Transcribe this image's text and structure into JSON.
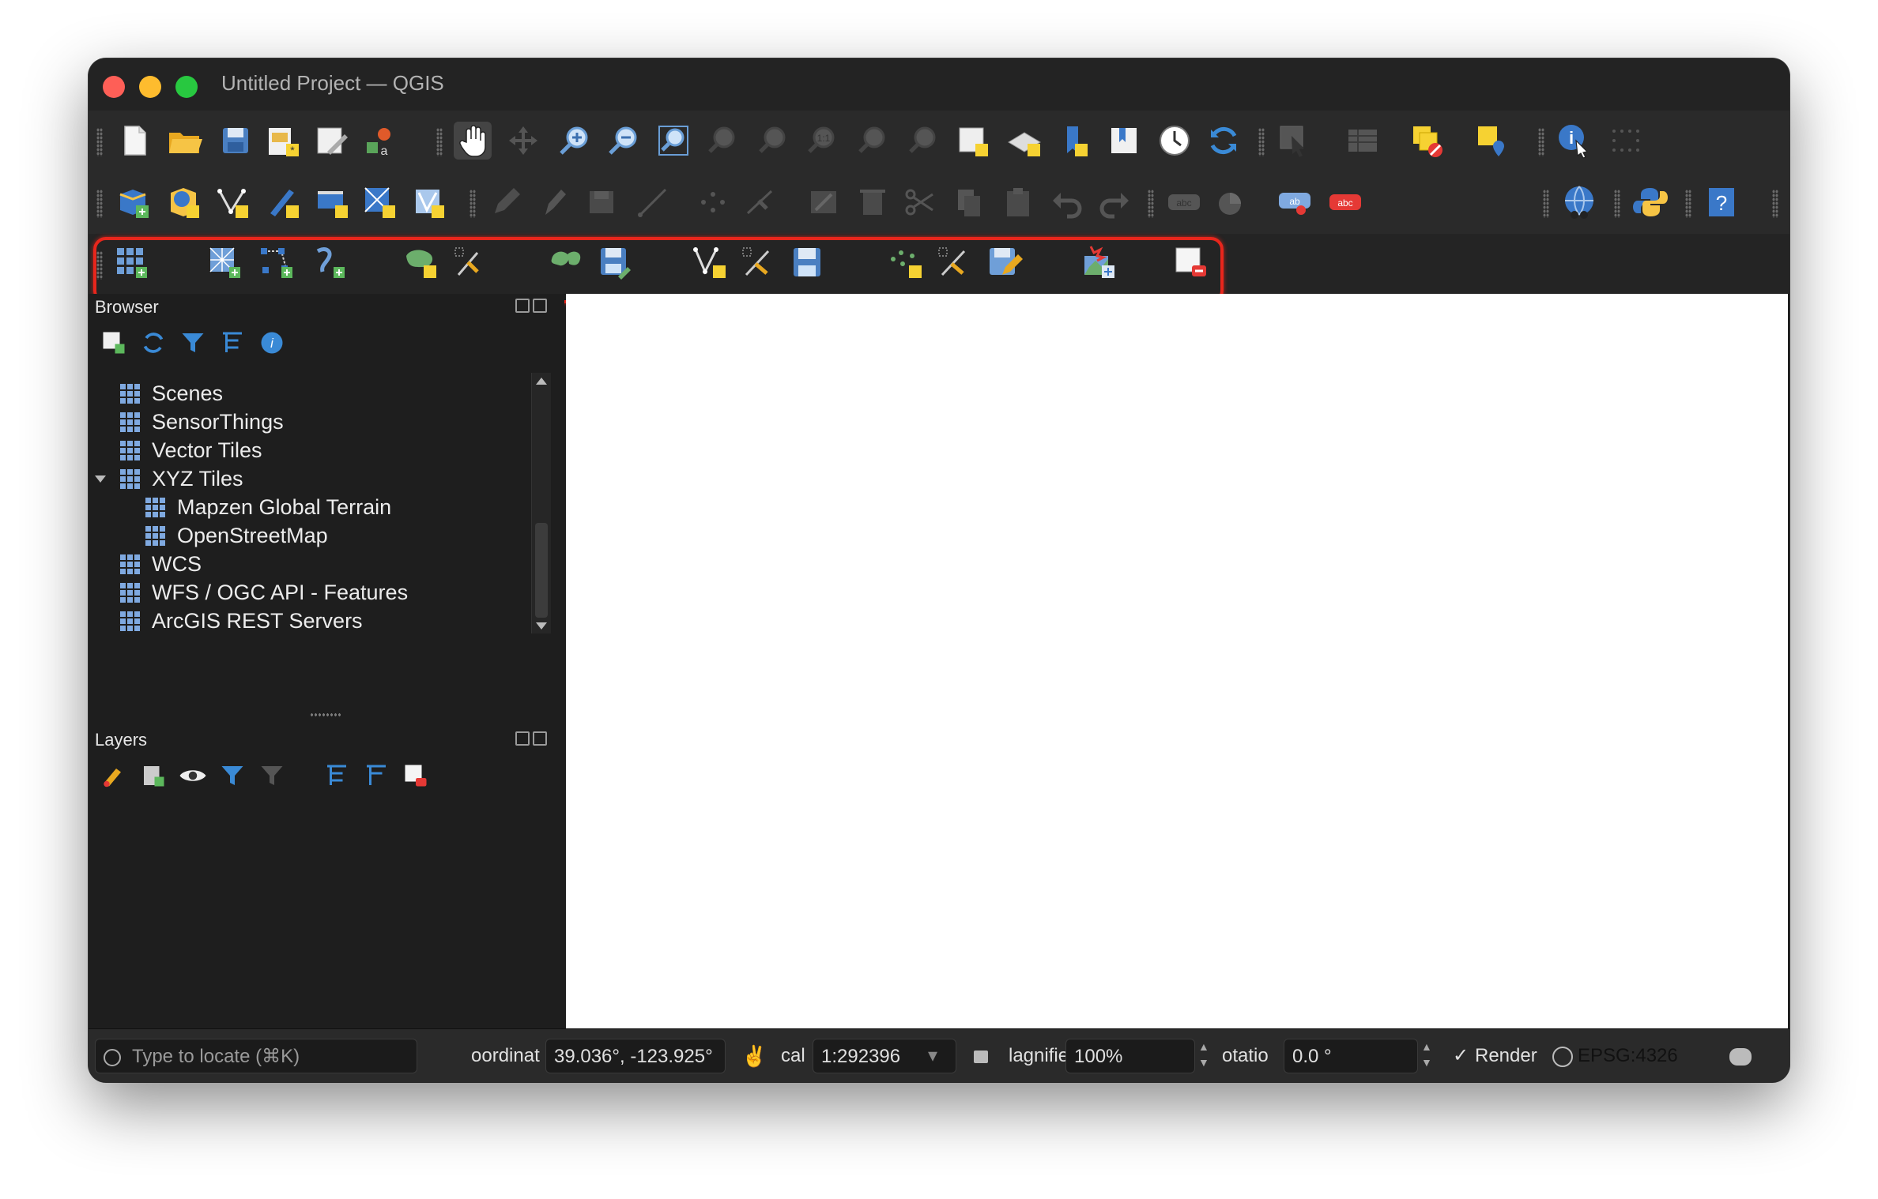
{
  "window": {
    "title": "Untitled Project — QGIS"
  },
  "toolbar_rows": {
    "row1": [
      "new-project-icon",
      "open-project-icon",
      "save-project-icon",
      "new-print-layout-icon",
      "layout-manager-icon",
      "style-manager-icon",
      "pan-map-icon",
      "pan-to-selection-icon",
      "zoom-in-icon",
      "zoom-out-icon",
      "zoom-full-icon",
      "zoom-to-selection-icon",
      "zoom-to-layer-icon",
      "zoom-native-icon",
      "zoom-last-icon",
      "zoom-next-icon",
      "new-map-view-icon",
      "new-3d-view-icon",
      "new-bookmark-icon",
      "show-bookmarks-icon",
      "temporal-controller-icon",
      "refresh-icon",
      "select-features-icon",
      "open-attribute-table-icon",
      "deselect-all-icon",
      "show-map-tips-icon",
      "identify-features-icon",
      "measure-icon"
    ],
    "row2": [
      "data-source-manager-icon",
      "new-geopackage-layer-icon",
      "digitize-vertex-icon",
      "new-sketch-icon",
      "new-memory-layer-icon",
      "new-virtual-layer-icon",
      "new-spatialite-layer-icon",
      "toggle-editing-icon",
      "current-edits-icon",
      "save-edits-icon",
      "digitize-line-icon",
      "add-point-icon",
      "vertex-tool-icon",
      "modify-attributes-icon",
      "delete-selected-icon",
      "cut-features-icon",
      "copy-features-icon",
      "paste-features-icon",
      "undo-icon",
      "redo-icon",
      "label-toolbar-icon",
      "diagram-icon",
      "label-highlight-icon",
      "label-pin-icon",
      "metasearch-icon",
      "python-console-icon",
      "help-icon"
    ]
  },
  "highlighted_toolbar": {
    "icons": [
      "add-wms-layer-icon",
      "add-wcs-layer-icon",
      "add-vector-tile-layer-icon",
      "add-xyz-layer-icon",
      "add-spatialite-layer-icon",
      "add-mesh-layer-icon",
      "add-virtual-layer-icon",
      "save-mesh-layer-icon",
      "add-delimited-text-icon",
      "add-postgis-layer-icon",
      "save-layer-icon",
      "add-point-cloud-icon",
      "add-gps-layer-icon",
      "edit-layer-icon",
      "add-raster-icon",
      "remove-layer-icon"
    ]
  },
  "browser": {
    "title": "Browser",
    "items": [
      {
        "label": "Scenes",
        "icon": "scenes-icon",
        "indent": 0
      },
      {
        "label": "SensorThings",
        "icon": "sensorthings-icon",
        "indent": 0
      },
      {
        "label": "Vector Tiles",
        "icon": "vector-tiles-icon",
        "indent": 0
      },
      {
        "label": "XYZ Tiles",
        "icon": "xyz-tiles-icon",
        "indent": 0,
        "expanded": true
      },
      {
        "label": "Mapzen Global Terrain",
        "icon": "tile-grid-icon",
        "indent": 1
      },
      {
        "label": "OpenStreetMap",
        "icon": "tile-grid-icon",
        "indent": 1
      },
      {
        "label": "WCS",
        "icon": "wcs-icon",
        "indent": 0
      },
      {
        "label": "WFS / OGC API - Features",
        "icon": "wfs-icon",
        "indent": 0
      },
      {
        "label": "ArcGIS REST Servers",
        "icon": "arcgis-icon",
        "indent": 0
      }
    ]
  },
  "layers": {
    "title": "Layers"
  },
  "statusbar": {
    "locator_placeholder": "Type to locate (⌘K)",
    "coordinate_label": "oordinat",
    "coordinate_value": "39.036°, -123.925°",
    "scale_label": "cal",
    "scale_value": "1:292396",
    "magnifier_label": "lagnifiе",
    "magnifier_value": "100%",
    "rotation_label": "otatio",
    "rotation_value": "0.0 °",
    "render_label": "Render",
    "render_check": "✓",
    "crs": "EPSG:4326"
  }
}
